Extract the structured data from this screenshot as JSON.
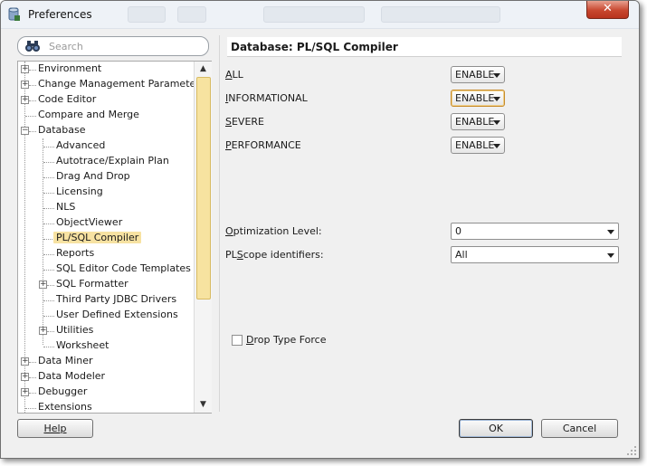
{
  "window": {
    "title": "Preferences",
    "close_label": "✕"
  },
  "search": {
    "placeholder": "Search",
    "value": ""
  },
  "tree": {
    "items": [
      {
        "label": "Environment",
        "expander": "+"
      },
      {
        "label": "Change Management Parameters",
        "expander": "+"
      },
      {
        "label": "Code Editor",
        "expander": "+"
      },
      {
        "label": "Compare and Merge",
        "expander": ""
      },
      {
        "label": "Database",
        "expander": "−"
      },
      {
        "label": "Advanced",
        "expander": ""
      },
      {
        "label": "Autotrace/Explain Plan",
        "expander": ""
      },
      {
        "label": "Drag And Drop",
        "expander": ""
      },
      {
        "label": "Licensing",
        "expander": ""
      },
      {
        "label": "NLS",
        "expander": ""
      },
      {
        "label": "ObjectViewer",
        "expander": ""
      },
      {
        "label": "PL/SQL Compiler",
        "expander": "",
        "selected": true
      },
      {
        "label": "Reports",
        "expander": ""
      },
      {
        "label": "SQL Editor Code Templates",
        "expander": ""
      },
      {
        "label": "SQL Formatter",
        "expander": "+"
      },
      {
        "label": "Third Party JDBC Drivers",
        "expander": ""
      },
      {
        "label": "User Defined Extensions",
        "expander": ""
      },
      {
        "label": "Utilities",
        "expander": "+"
      },
      {
        "label": "Worksheet",
        "expander": ""
      },
      {
        "label": "Data Miner",
        "expander": "+"
      },
      {
        "label": "Data Modeler",
        "expander": "+"
      },
      {
        "label": "Debugger",
        "expander": "+"
      },
      {
        "label": "Extensions",
        "expander": ""
      }
    ]
  },
  "page": {
    "title": "Database: PL/SQL Compiler",
    "warnings": [
      {
        "mnemonic": "A",
        "rest": "LL",
        "value": "ENABLE"
      },
      {
        "mnemonic": "I",
        "rest": "NFORMATIONAL",
        "value": "ENABLE"
      },
      {
        "mnemonic": "S",
        "rest": "EVERE",
        "value": "ENABLE"
      },
      {
        "mnemonic": "P",
        "rest": "ERFORMANCE",
        "value": "ENABLE"
      }
    ],
    "optimization": {
      "mnemonic": "O",
      "rest": "ptimization Level:",
      "value": "0"
    },
    "plscope": {
      "prefix": "PL",
      "mnemonic": "S",
      "rest": "cope identifiers:",
      "value": "All"
    },
    "drop_type_force": {
      "mnemonic": "D",
      "rest": "rop Type Force",
      "checked": false
    }
  },
  "buttons": {
    "help": "Help",
    "ok": "OK",
    "cancel": "Cancel"
  },
  "colors": {
    "selection": "#f7e2a2",
    "scroll_thumb": "#f7e3a0",
    "close": "#c8472f"
  }
}
